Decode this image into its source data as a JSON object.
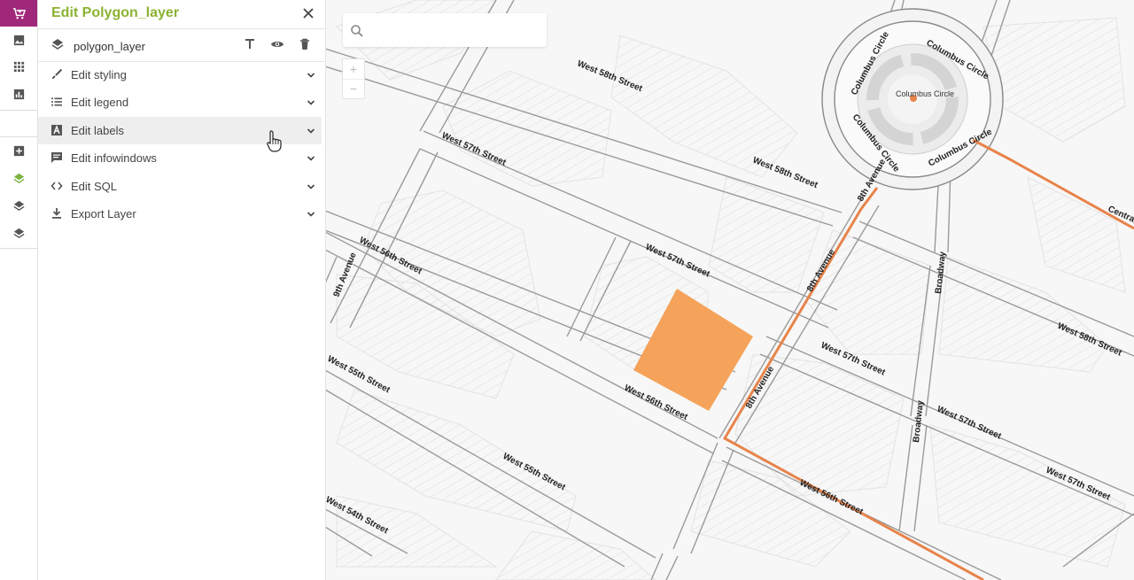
{
  "rail": {
    "items": [
      {
        "name": "marketplace",
        "active": true
      },
      {
        "name": "images"
      },
      {
        "name": "apps"
      },
      {
        "name": "charts"
      },
      {
        "name": "add-layer"
      },
      {
        "name": "layer-active"
      },
      {
        "name": "layer-2"
      },
      {
        "name": "layer-3"
      }
    ]
  },
  "panel": {
    "title": "Edit Polygon_layer",
    "layer_name": "polygon_layer",
    "menu": [
      {
        "label": "Edit styling",
        "icon": "brush-icon"
      },
      {
        "label": "Edit legend",
        "icon": "list-icon"
      },
      {
        "label": "Edit labels",
        "icon": "label-icon",
        "hover": true
      },
      {
        "label": "Edit infowindows",
        "icon": "comment-icon"
      },
      {
        "label": "Edit SQL",
        "icon": "code-icon"
      },
      {
        "label": "Export Layer",
        "icon": "download-icon"
      }
    ]
  },
  "map": {
    "search_placeholder": "",
    "zoom_in": "+",
    "zoom_out": "−",
    "polygon_color": "#f5a35a",
    "route_color": "#e8834a",
    "labels": {
      "w58_a": "West 58th Street",
      "w58_b": "West 58th Street",
      "w58_c": "West 58th Street",
      "w57_a": "West 57th Street",
      "w57_b": "West 57th Street",
      "w57_c": "West 57th Street",
      "w57_d": "West 57th Street",
      "w57_e": "West 57th Street",
      "w56_a": "West 56th Street",
      "w56_b": "West 56th Street",
      "w56_c": "West 56th Street",
      "w55_a": "West 55th Street",
      "w55_b": "West 55th Street",
      "w54": "West 54th Street",
      "ninth": "9th Avenue",
      "eighth_a": "8th Avenue",
      "eighth_b": "8th Avenue",
      "eighth_c": "8th Avenue",
      "broadway_a": "Broadway",
      "broadway_b": "Broadway",
      "cc1": "Columbus Circle",
      "cc2": "Columbus Circle",
      "cc3": "Columbus Circle",
      "cc4": "Columbus Circle",
      "cc5": "Columbus Circle",
      "cc_center": "Columbus Circle",
      "central": "Central"
    }
  }
}
